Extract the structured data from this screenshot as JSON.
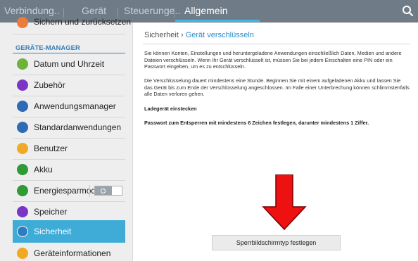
{
  "tabs": [
    {
      "label": "Verbindung.."
    },
    {
      "label": "Gerät"
    },
    {
      "label": "Steuerunge.."
    },
    {
      "label": "Allgemein"
    }
  ],
  "active_tab": "Allgemein",
  "colors": {
    "topbar": "#6f7c87",
    "accent": "#3fb8e3",
    "selected": "#3eacd6",
    "arrow": "#ee1111"
  },
  "sidebar": {
    "top_item": {
      "label": "Sichern und zurücksetzen",
      "icon": "backup-icon",
      "color": "#ef7a3c"
    },
    "section_header": "GERÄTE-MANAGER",
    "items": [
      {
        "label": "Datum und Uhrzeit",
        "icon": "clock-icon",
        "color": "#6cb33a"
      },
      {
        "label": "Zubehör",
        "icon": "accessory-icon",
        "color": "#7b35c6"
      },
      {
        "label": "Anwendungsmanager",
        "icon": "apps-icon",
        "color": "#2f6bb5"
      },
      {
        "label": "Standardanwendungen",
        "icon": "default-apps-icon",
        "color": "#2f6bb5"
      },
      {
        "label": "Benutzer",
        "icon": "user-icon",
        "color": "#f1a928"
      },
      {
        "label": "Akku",
        "icon": "battery-icon",
        "color": "#2e9b36"
      },
      {
        "label": "Energiesparmod..",
        "icon": "power-saving-icon",
        "color": "#2e9b36",
        "toggle": "off"
      },
      {
        "label": "Speicher",
        "icon": "storage-icon",
        "color": "#7b35c6"
      },
      {
        "label": "Sicherheit",
        "icon": "lock-icon",
        "color": "#2d7dc0",
        "selected": true
      },
      {
        "label": "Geräteinformationen",
        "icon": "info-icon",
        "color": "#f2a81f"
      }
    ]
  },
  "main": {
    "breadcrumb_parent": "Sicherheit",
    "breadcrumb_sep": "›",
    "breadcrumb_current": "Gerät verschlüsseln",
    "paragraph1": "Sie können Konten, Einstellungen und heruntergeladene Anwendungen einschließlich Daten, Medien und andere Dateien verschlüsseln. Wenn Ihr Gerät verschlüsselt ist, müssen Sie bei jedem Einschalten eine PIN oder ein Passwort eingeben, um es zu entschlüsseln.",
    "paragraph2": "Die Verschlüsselung dauert mindestens eine Stunde. Beginnen Sie mit einem aufgeladenen Akku und lassen Sie das Gerät bis zum Ende der Verschlüsselung angeschlossen. Im Falle einer Unterbrechung können schlimmstenfalls alle Daten verloren gehen.",
    "req1": "Ladegerät einstecken",
    "req2": "Passwort zum Entsperren mit mindestens 6 Zeichen festlegen, darunter mindestens 1 Ziffer.",
    "button_label": "Sperrbildschirmtyp festlegen"
  },
  "annotation": {
    "icon": "arrow-down-icon"
  }
}
